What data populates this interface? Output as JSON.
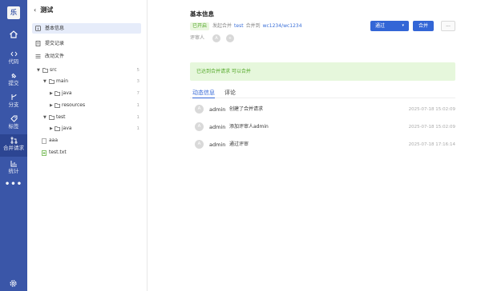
{
  "rail": {
    "logo": "乐",
    "items": [
      {
        "label": "",
        "icon": "home-icon"
      },
      {
        "label": "代码",
        "icon": "code-icon"
      },
      {
        "label": "提交",
        "icon": "commit-icon"
      },
      {
        "label": "分支",
        "icon": "branch-icon"
      },
      {
        "label": "标签",
        "icon": "tag-icon"
      },
      {
        "label": "合并请求",
        "icon": "merge-request-icon"
      },
      {
        "label": "统计",
        "icon": "chart-icon"
      }
    ],
    "more": "•••",
    "active_index": 5,
    "accent": "#3a56a8"
  },
  "panel": {
    "back_glyph": "‹",
    "title": "测试",
    "menu": [
      {
        "label": "基本信息",
        "icon": "info-icon"
      },
      {
        "label": "提交记录",
        "icon": "document-icon"
      },
      {
        "label": "改动文件",
        "icon": "list-icon"
      }
    ],
    "tree": [
      {
        "name": "src",
        "type": "folder",
        "expanded": true,
        "count": "5"
      },
      {
        "name": "main",
        "type": "folder",
        "expanded": true,
        "count": "3"
      },
      {
        "name": "java",
        "type": "folder",
        "expanded": false,
        "count": "7"
      },
      {
        "name": "resources",
        "type": "folder",
        "expanded": false,
        "count": "1"
      },
      {
        "name": "test",
        "type": "folder",
        "expanded": true,
        "count": "1"
      },
      {
        "name": "java",
        "type": "folder",
        "expanded": false,
        "count": "1"
      },
      {
        "name": "aaa",
        "type": "file",
        "count": ""
      },
      {
        "name": "test.txt",
        "type": "file-added",
        "count": ""
      }
    ]
  },
  "main": {
    "title": "基本信息",
    "status_badge": "已开启",
    "initiator_label": "发起合并",
    "initiator": "test",
    "merge_to_label": "合并到",
    "branches": "wc1234/wc1234",
    "reviewers_label": "评审人",
    "reviewer_avatars": [
      "A",
      "+"
    ],
    "approve_button": "通过",
    "approve_caret": "▾",
    "merge_button": "合并",
    "more_button": "...",
    "alert": "已达到合并请求 可以合并",
    "tabs": [
      "动态信息",
      "评论"
    ],
    "activities": [
      {
        "avatar": "A",
        "user": "admin",
        "message": "创建了合并请求",
        "time": "2025-07-18 15:02:09"
      },
      {
        "avatar": "A",
        "user": "admin",
        "message": "添加评审人admin",
        "time": "2025-07-18 15:02:09"
      },
      {
        "avatar": "A",
        "user": "admin",
        "message": "通过评审",
        "time": "2025-07-18 17:16:14"
      }
    ]
  }
}
